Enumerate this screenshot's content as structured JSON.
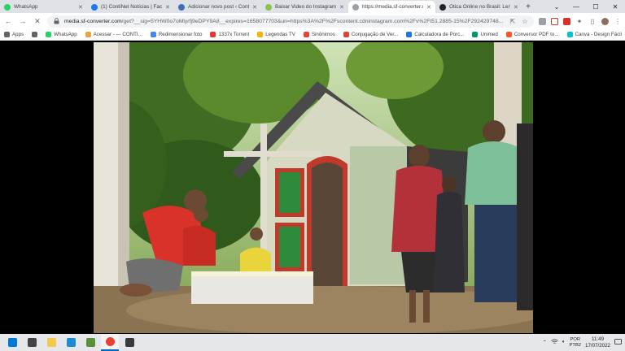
{
  "tabs": [
    {
      "label": "WhatsApp",
      "color": "#25d366",
      "active": false
    },
    {
      "label": "(1) ContiNet Notícias | Face",
      "color": "#1877f2",
      "active": false
    },
    {
      "label": "Adicionar novo post ‹ Conti...",
      "color": "#3b6fb6",
      "active": false
    },
    {
      "label": "Baixar Video do Instagram",
      "color": "#8bc34a",
      "active": false
    },
    {
      "label": "https://media.sf-converter.c",
      "color": "#9aa0a6",
      "active": true
    },
    {
      "label": "Ótica Online no Brasil: Lent",
      "color": "#222222",
      "active": false
    }
  ],
  "newtab_label": "+",
  "window_controls": {
    "minimize": "—",
    "maximize": "☐",
    "close": "✕"
  },
  "address": {
    "domain": "media.sf-converter.com",
    "path": "/get?__sig=5YHW0o7oMlyrfj9eDPY9A8__expires=1658077703&uri=https%3A%2F%2Fscontent.cdninstagram.com%2Fv%2Ft51.2885-15%2F292429748..."
  },
  "bookmarks": [
    {
      "label": "Apps",
      "color": "#5f6368"
    },
    {
      "label": "",
      "color": "#5f6368"
    },
    {
      "label": "WhatsApp",
      "color": "#25d366"
    },
    {
      "label": "Acessar - --- CONTI...",
      "color": "#e8a33d"
    },
    {
      "label": "Redimensionar foto",
      "color": "#4285f4"
    },
    {
      "label": "1337x Torrent",
      "color": "#e53935"
    },
    {
      "label": "Legendas TV",
      "color": "#f4b400"
    },
    {
      "label": "Sinônimos",
      "color": "#ea4335"
    },
    {
      "label": "Conjugação de Ver...",
      "color": "#db4437"
    },
    {
      "label": "Calculadora de Porc...",
      "color": "#1a73e8"
    },
    {
      "label": "Unimed",
      "color": "#00995d"
    },
    {
      "label": "Conversor PDF to...",
      "color": "#ff5722"
    },
    {
      "label": "Canva - Design Fácil",
      "color": "#00c4cc"
    }
  ],
  "taskbar": {
    "apps": [
      {
        "name": "windows-start-icon",
        "active": false
      },
      {
        "name": "task-view-icon",
        "active": false
      },
      {
        "name": "file-explorer-icon",
        "active": false
      },
      {
        "name": "edge-icon",
        "active": false
      },
      {
        "name": "minecraft-icon",
        "active": false
      },
      {
        "name": "chrome-icon",
        "active": true
      },
      {
        "name": "photos-icon",
        "active": false
      }
    ],
    "lang_line1": "POR",
    "lang_line2": "PTB2",
    "time": "11:49",
    "date": "17/07/2022"
  }
}
